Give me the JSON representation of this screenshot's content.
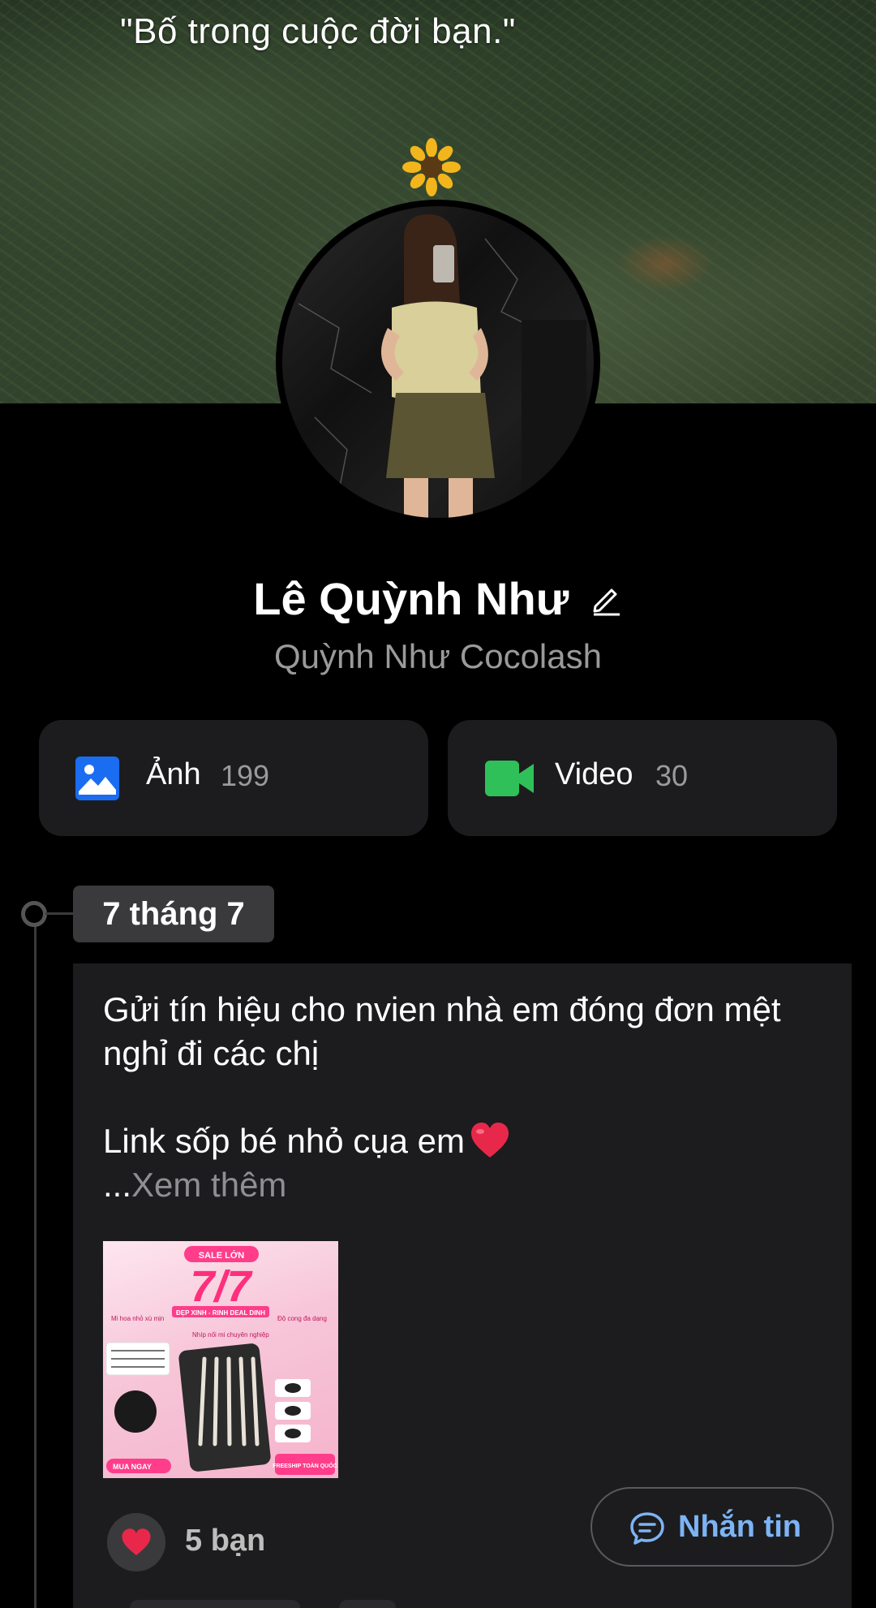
{
  "cover": {
    "quote": "\"Bố trong cuộc đời bạn.\""
  },
  "profile": {
    "name": "Lê Quỳnh Như",
    "alias": "Quỳnh Như Cocolash"
  },
  "media": {
    "photos": {
      "label": "Ảnh",
      "count": "199",
      "icon": "image-icon",
      "color": "#1a6cf0"
    },
    "videos": {
      "label": "Video",
      "count": "30",
      "icon": "video-camera-icon",
      "color": "#30c05a"
    }
  },
  "timeline": {
    "date": "7 tháng 7"
  },
  "post": {
    "line1": "Gửi tín hiệu cho nvien nhà em đóng đơn mệt nghỉ đi các chị",
    "line2": "Link sốp bé nhỏ cụa em",
    "see_more_prefix": "...",
    "see_more": "Xem thêm",
    "image_texts": {
      "badge": "SALE LỚN",
      "big": "7/7",
      "tagline": "ĐẸP XINH - RINH DEAL DINH",
      "left_caption": "Mi hoa nhỏ xù mịn",
      "mid_caption": "Nhíp nối mi chuyên nghiệp",
      "right_caption": "Độ cong đa dạng",
      "cta": "MUA NGAY",
      "freeship": "FREESHIP TOÀN QUỐC"
    },
    "reactions": "5 bạn",
    "message_button": "Nhắn tin"
  },
  "colors": {
    "accent_blue": "#7cb4f5",
    "heart": "#e8284a"
  }
}
